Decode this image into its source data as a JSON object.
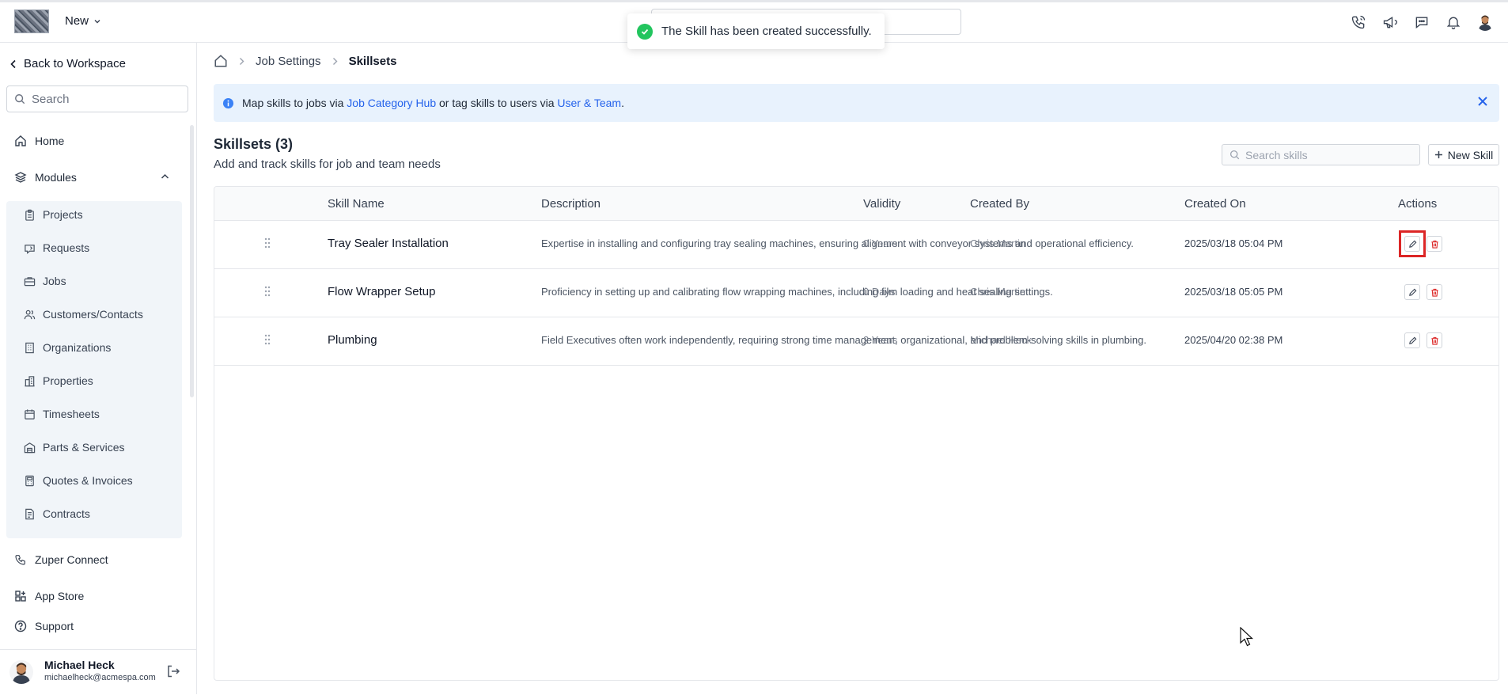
{
  "topbar": {
    "new_label": "New",
    "toast_message": "The Skill has been created successfully.",
    "icons": [
      "phone-icon",
      "megaphone-icon",
      "chat-icon",
      "bell-icon",
      "profile-avatar"
    ]
  },
  "sidebar": {
    "back_label": "Back to Workspace",
    "search_placeholder": "Search",
    "home": "Home",
    "modules": "Modules",
    "module_items": [
      "Projects",
      "Requests",
      "Jobs",
      "Customers/Contacts",
      "Organizations",
      "Properties",
      "Timesheets",
      "Parts & Services",
      "Quotes & Invoices",
      "Contracts"
    ],
    "bottom_items": [
      "Zuper Connect",
      "App Store",
      "Support"
    ],
    "user": {
      "name": "Michael Heck",
      "email": "michaelheck@acmespa.com"
    }
  },
  "breadcrumb": {
    "parent": "Job Settings",
    "current": "Skillsets"
  },
  "banner": {
    "text_1": "Map skills to jobs via ",
    "link_1": "Job Category Hub",
    "text_2": " or tag skills to users via ",
    "link_2": "User & Team",
    "text_3": "."
  },
  "page": {
    "title": "Skillsets (3)",
    "subtitle": "Add and track skills for job and team needs",
    "search_placeholder": "Search skills",
    "new_skill_label": "New Skill"
  },
  "table": {
    "headers": {
      "name": "Skill Name",
      "description": "Description",
      "validity": "Validity",
      "created_by": "Created By",
      "created_on": "Created On",
      "actions": "Actions"
    },
    "rows": [
      {
        "name": "Tray Sealer Installation",
        "description": "Expertise in installing and configuring tray sealing machines, ensuring alignment with conveyor systems and operational efficiency.",
        "validity": "0 Years",
        "created_by": "Chris Martin",
        "created_on": "2025/03/18 05:04 PM"
      },
      {
        "name": "Flow Wrapper Setup",
        "description": "Proficiency in setting up and calibrating flow wrapping machines, including film loading and heat sealing settings.",
        "validity": "0 Days",
        "created_by": "Chris Martin",
        "created_on": "2025/03/18 05:05 PM"
      },
      {
        "name": "Plumbing",
        "description": "Field Executives often work independently, requiring strong time management, organizational, and problem-solving skills in plumbing.",
        "validity": "2 Years",
        "created_by": "Michael Heck",
        "created_on": "2025/04/20 02:38 PM"
      }
    ]
  },
  "colors": {
    "accent": "#2563eb",
    "success": "#22c55e",
    "danger": "#dc2626",
    "banner_bg": "#e8f2fd"
  }
}
